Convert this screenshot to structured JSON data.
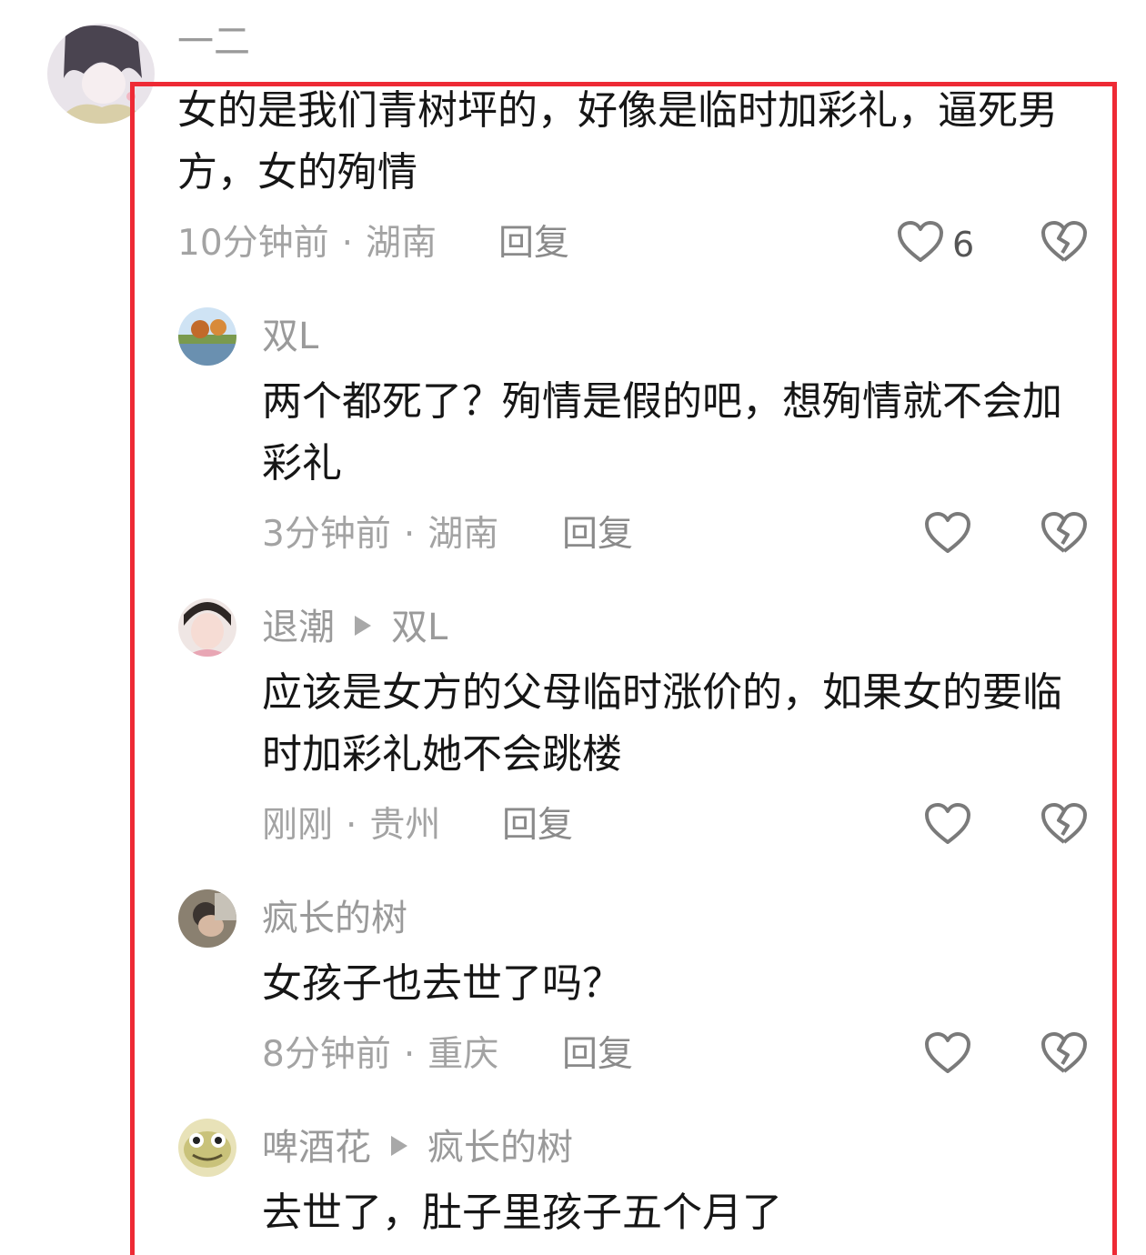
{
  "main_comment": {
    "username": "一二",
    "text": "女的是我们青树坪的，好像是临时加彩礼，逼死男方，女的殉情",
    "time": "10分钟前",
    "location": "湖南",
    "reply_label": "回复",
    "like_count": "6"
  },
  "replies": [
    {
      "username": "双L",
      "reply_to": "",
      "text": "两个都死了？殉情是假的吧，想殉情就不会加彩礼",
      "time": "3分钟前",
      "location": "湖南",
      "reply_label": "回复"
    },
    {
      "username": "退潮",
      "reply_to": "双L",
      "text": "应该是女方的父母临时涨价的，如果女的要临时加彩礼她不会跳楼",
      "time": "刚刚",
      "location": "贵州",
      "reply_label": "回复"
    },
    {
      "username": "疯长的树",
      "reply_to": "",
      "text": "女孩子也去世了吗？",
      "time": "8分钟前",
      "location": "重庆",
      "reply_label": "回复"
    },
    {
      "username": "啤酒花",
      "reply_to": "疯长的树",
      "text": "去世了，肚子里孩子五个月了"
    }
  ],
  "meta_separator": "·",
  "icons": {
    "like": "heart-outline-icon",
    "dislike": "broken-heart-icon",
    "reply_arrow": "triangle-right-icon"
  },
  "colors": {
    "highlight_border": "#ee2a35",
    "username": "#9a9a9a",
    "meta": "#a3a3a3",
    "text": "#161616"
  }
}
